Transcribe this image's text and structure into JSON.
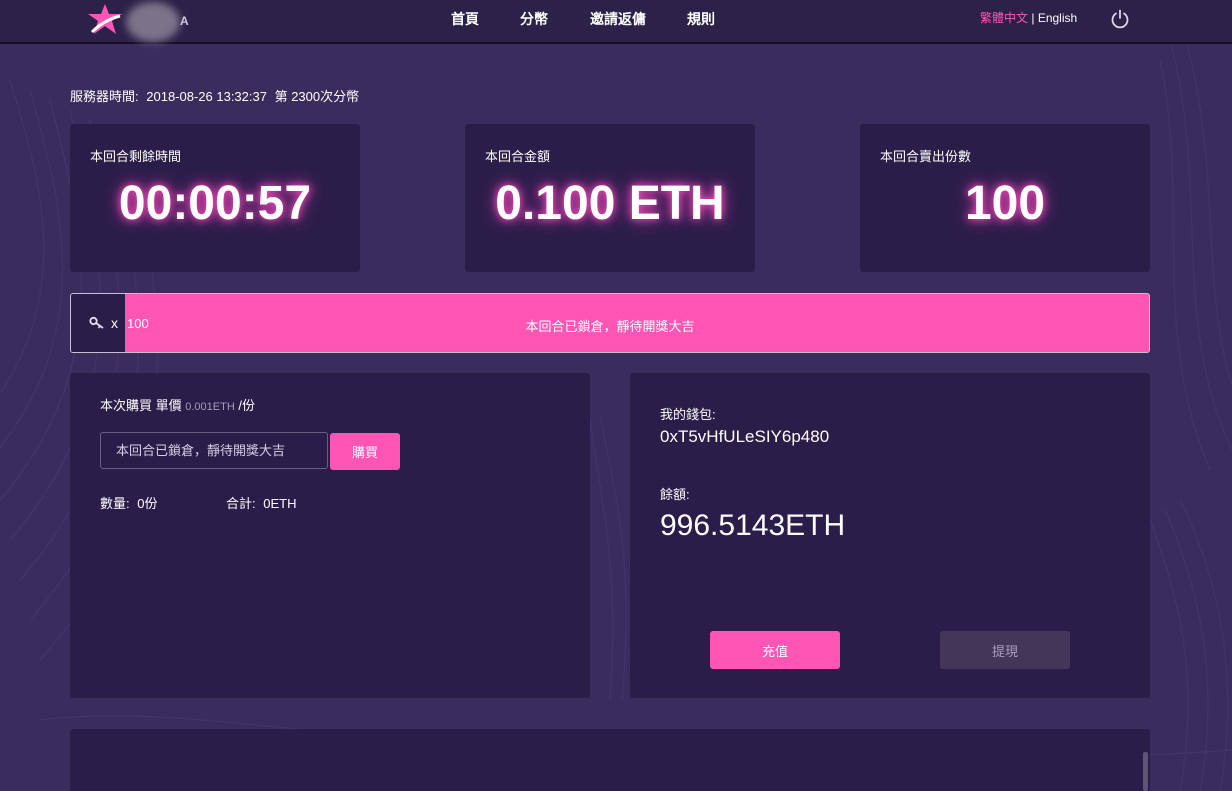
{
  "header": {
    "nav": [
      "首頁",
      "分幣",
      "邀請返傭",
      "規則"
    ],
    "lang_zh": "繁體中文",
    "lang_sep": "|",
    "lang_en": "English",
    "logo_partial": "A"
  },
  "server": {
    "label": "服務器時間:",
    "datetime": "2018-08-26 13:32:37",
    "round": "第 2300次分幣"
  },
  "stats": [
    {
      "label": "本回合剩餘時間",
      "value": "00:00:57"
    },
    {
      "label": "本回合金額",
      "value": "0.100 ETH"
    },
    {
      "label": "本回合賣出份數",
      "value": "100"
    }
  ],
  "progress": {
    "x": "x",
    "count": "100",
    "status": "本回合已鎖倉，靜待開獎大吉"
  },
  "buy": {
    "title": "本次購買 單價",
    "price": "0.001ETH",
    "unit": "/份",
    "placeholder": "本回合已鎖倉，靜待開獎大吉",
    "button": "購買",
    "qty_label": "數量:",
    "qty_value": "0份",
    "total_label": "合計:",
    "total_value": "0ETH"
  },
  "wallet": {
    "label": "我的錢包:",
    "address": "0xT5vHfULeSIY6p480",
    "balance_label": "餘額:",
    "balance": "996.5143ETH",
    "deposit": "充值",
    "withdraw": "提現"
  },
  "colors": {
    "accent": "#ff55b4",
    "background": "#3a2d5e",
    "card": "#2b1d4a",
    "header": "#2c2148"
  },
  "icons": [
    "star-logo-icon",
    "power-icon",
    "key-icon"
  ]
}
